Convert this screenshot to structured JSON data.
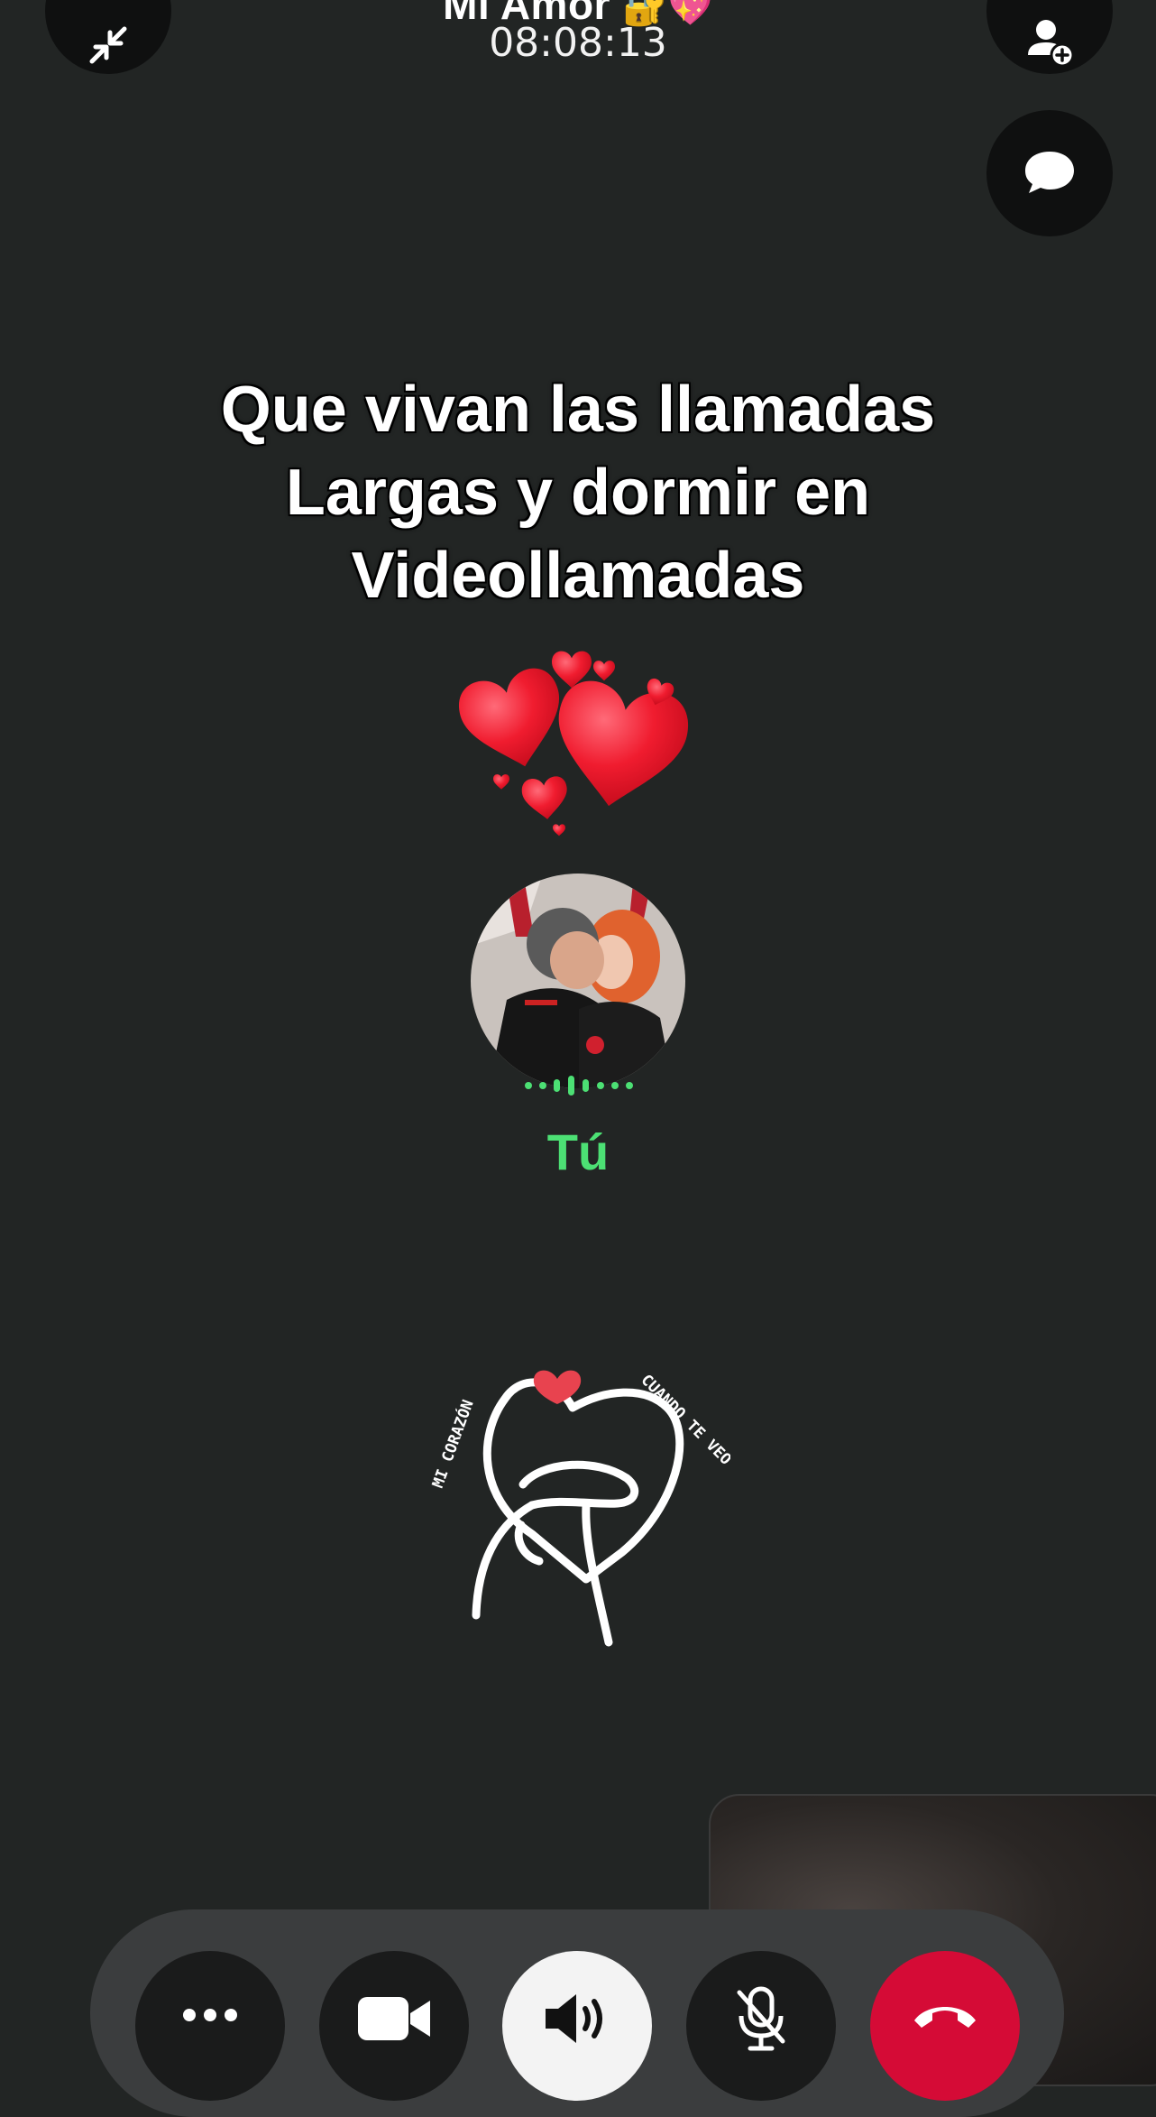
{
  "header": {
    "contact_name": "Mi Amor",
    "contact_emojis": "🔐💖",
    "call_duration": "08:08:13"
  },
  "top_buttons": [
    {
      "icon": "minimize-icon",
      "action": "Minimize call"
    },
    {
      "icon": "add-person-icon",
      "action": "Add participant"
    },
    {
      "icon": "chat-icon",
      "action": "Open chat"
    }
  ],
  "overlay_caption": {
    "line1": "Que vivan las llamadas",
    "line2": "Largas y dormir en",
    "line3": "Videollamadas"
  },
  "participant": {
    "label": "Tú",
    "speaking": true
  },
  "sticker": {
    "text_left": "MI CORAZÓN",
    "text_right": "CUANDO TE VEO"
  },
  "controls": [
    {
      "icon": "more-icon"
    },
    {
      "icon": "video-camera-icon"
    },
    {
      "icon": "speaker-icon",
      "active": true
    },
    {
      "icon": "mic-muted-icon"
    },
    {
      "icon": "end-call-icon"
    }
  ],
  "colors": {
    "background": "#222524",
    "speaking_green": "#4ce074",
    "end_call_red": "#d50b36",
    "heart_red": "#e8213a"
  }
}
